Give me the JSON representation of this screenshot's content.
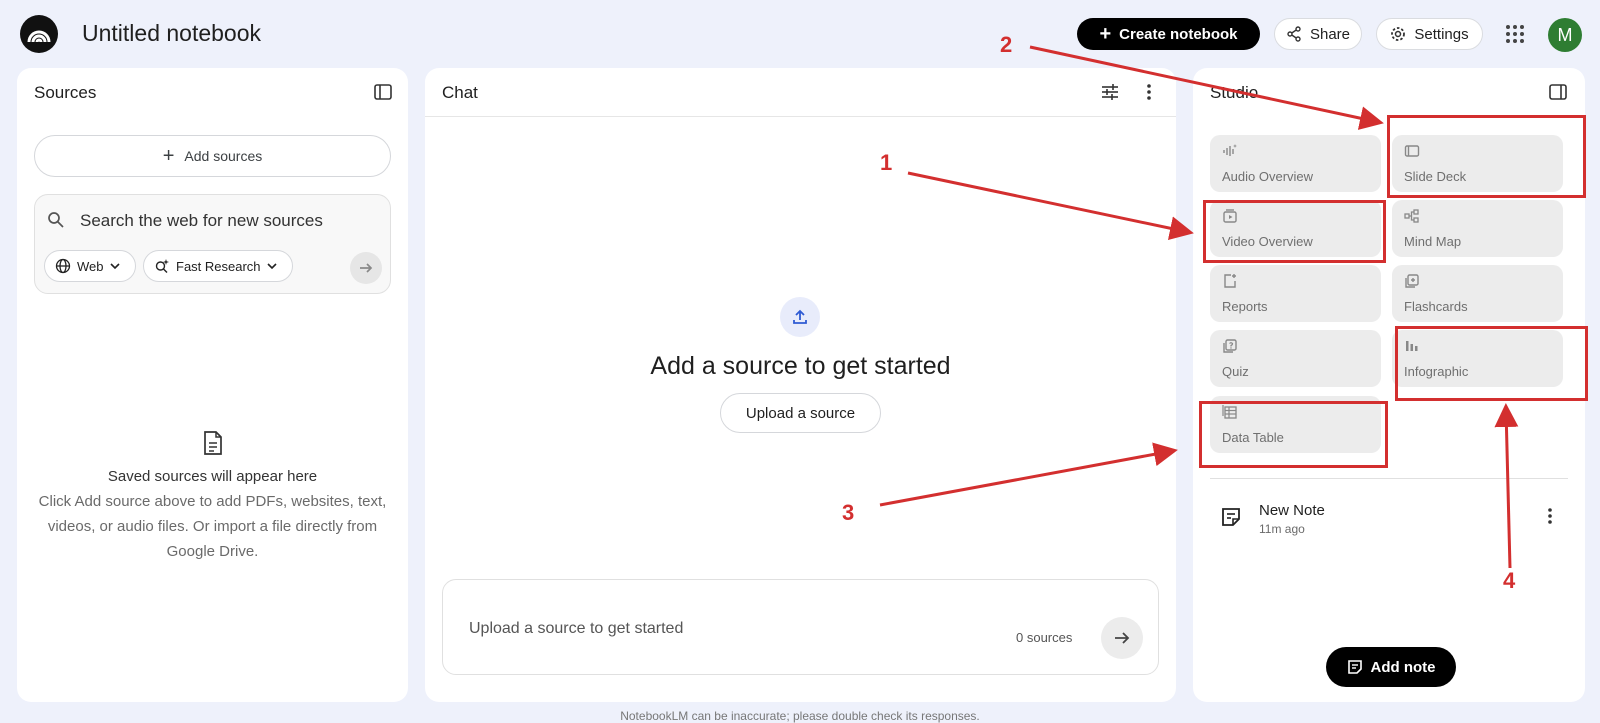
{
  "header": {
    "title": "Untitled notebook",
    "create_label": "Create notebook",
    "share_label": "Share",
    "settings_label": "Settings",
    "avatar_initial": "M"
  },
  "sources": {
    "title": "Sources",
    "add_label": "Add sources",
    "search_placeholder": "Search the web for new sources",
    "web_chip": "Web",
    "fast_chip": "Fast Research",
    "empty_title": "Saved sources will appear here",
    "empty_desc": "Click Add source above to add PDFs, websites, text, videos, or audio files. Or import a file directly from Google Drive."
  },
  "chat": {
    "title": "Chat",
    "empty_title": "Add a source to get started",
    "upload_label": "Upload a source",
    "input_placeholder": "Upload a source to get started",
    "source_count": "0 sources"
  },
  "studio": {
    "title": "Studio",
    "tiles": [
      {
        "label": "Audio Overview",
        "icon": "audio-wave-icon"
      },
      {
        "label": "Slide Deck",
        "icon": "slides-icon"
      },
      {
        "label": "Video Overview",
        "icon": "video-icon"
      },
      {
        "label": "Mind Map",
        "icon": "mind-map-icon"
      },
      {
        "label": "Reports",
        "icon": "report-icon"
      },
      {
        "label": "Flashcards",
        "icon": "flashcards-icon"
      },
      {
        "label": "Quiz",
        "icon": "quiz-icon"
      },
      {
        "label": "Infographic",
        "icon": "bar-chart-icon"
      },
      {
        "label": "Data Table",
        "icon": "table-icon"
      }
    ],
    "note": {
      "title": "New Note",
      "time": "11m ago"
    },
    "add_note_label": "Add note"
  },
  "footer": {
    "disclaimer": "NotebookLM can be inaccurate; please double check its responses."
  },
  "annotations": {
    "color": "#d32f2f",
    "labels": [
      "1",
      "2",
      "3",
      "4"
    ]
  }
}
